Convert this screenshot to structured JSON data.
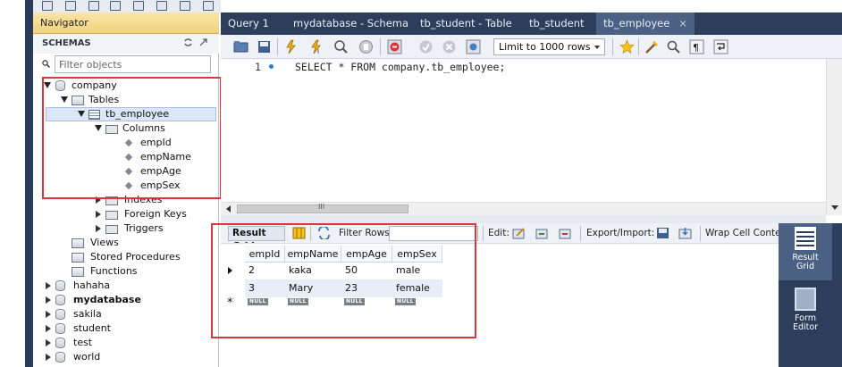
{
  "navigator": {
    "title": "Navigator",
    "schemas_label": "SCHEMAS",
    "filter_placeholder": "Filter objects",
    "tree": {
      "company": "company",
      "tables": "Tables",
      "tb_employee": "tb_employee",
      "columns": "Columns",
      "cols": [
        "empId",
        "empName",
        "empAge",
        "empSex"
      ],
      "indexes": "Indexes",
      "foreign_keys": "Foreign Keys",
      "triggers": "Triggers",
      "views": "Views",
      "stored_procedures": "Stored Procedures",
      "functions": "Functions",
      "schemas": [
        "hahaha",
        "mydatabase",
        "sakila",
        "student",
        "test",
        "world"
      ]
    }
  },
  "tabs": [
    {
      "label": "Query 1"
    },
    {
      "label": "mydatabase - Schema"
    },
    {
      "label": "tb_student - Table"
    },
    {
      "label": "tb_student"
    },
    {
      "label": "tb_employee",
      "close": "×"
    }
  ],
  "query_toolbar": {
    "limit_label": "Limit to 1000 rows"
  },
  "editor": {
    "line_number": "1",
    "sql": "SELECT * FROM company.tb_employee;"
  },
  "scroll": {
    "grip": "III"
  },
  "result_toolbar": {
    "result_grid": "Result Grid",
    "filter_rows": "Filter Rows:",
    "edit": "Edit:",
    "export_import": "Export/Import:",
    "wrap": "Wrap Cell Conten"
  },
  "grid": {
    "columns": [
      "empId",
      "empName",
      "empAge",
      "empSex"
    ],
    "rows": [
      [
        "2",
        "kaka",
        "50",
        "male"
      ],
      [
        "3",
        "Mary",
        "23",
        "female"
      ]
    ],
    "null_label": "NULL",
    "new_row_marker": "*"
  },
  "side_panel": {
    "result_grid_line1": "Result",
    "result_grid_line2": "Grid",
    "form_editor_line1": "Form",
    "form_editor_line2": "Editor"
  },
  "colors": {
    "tab_bar": "#2c3e5c",
    "active_tab": "#4b6184",
    "highlight_box": "#d9363e",
    "navigator_header": "#f1d27e"
  }
}
